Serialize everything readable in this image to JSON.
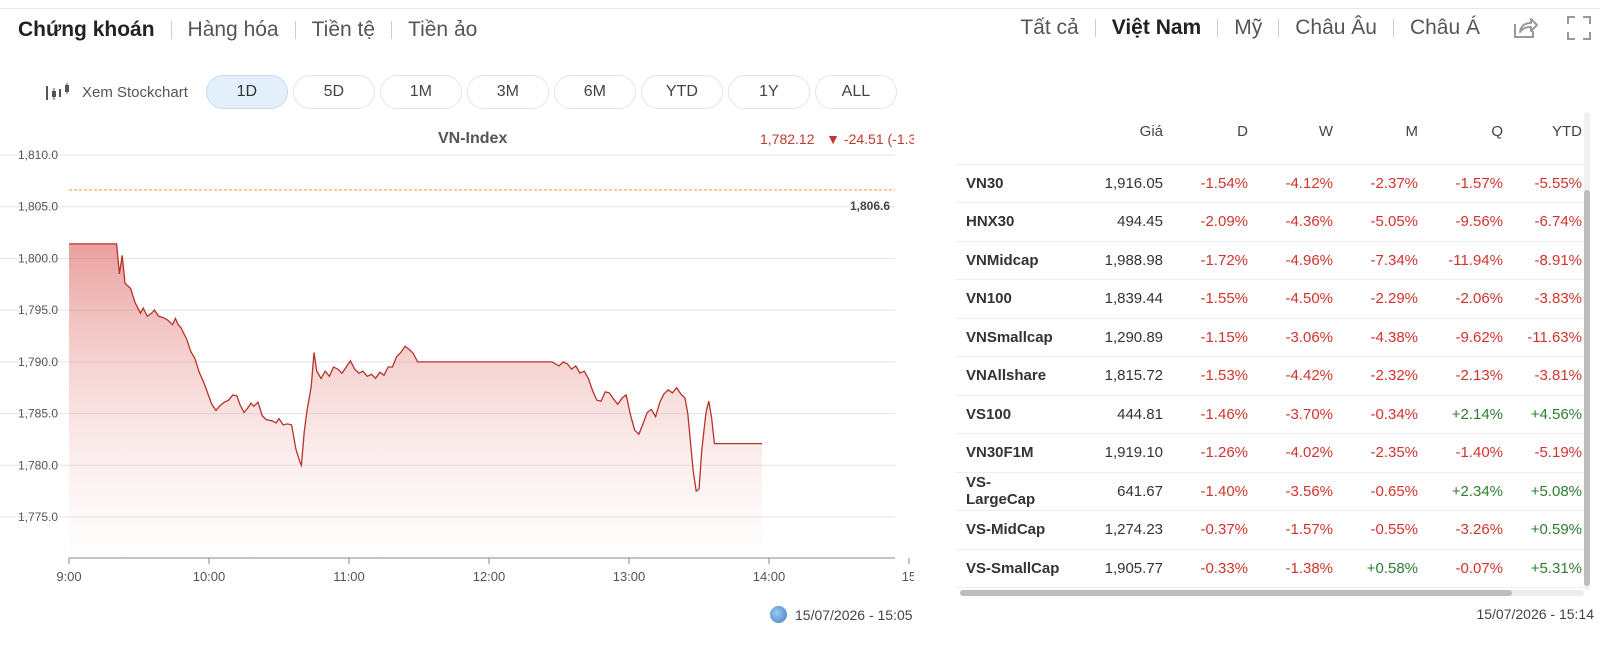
{
  "nav_left": [
    "Chứng khoán",
    "Hàng hóa",
    "Tiền tệ",
    "Tiền ảo"
  ],
  "nav_right": [
    "Tất cả",
    "Việt Nam",
    "Mỹ",
    "Châu Âu",
    "Châu Á"
  ],
  "nav_right_active": "Việt Nam",
  "icons": {
    "share": "share-icon",
    "fullscreen": "fullscreen-icon",
    "stockchart": "candlestick-icon",
    "globe": "globe-icon"
  },
  "toolbar": {
    "stockchart_label": "Xem Stockchart",
    "ranges": [
      "1D",
      "5D",
      "1M",
      "3M",
      "6M",
      "YTD",
      "1Y",
      "ALL"
    ],
    "active_range": "1D"
  },
  "chart": {
    "last_price": "1,782.12",
    "change_text": "▼ -24.51  (-1.3",
    "ref_label": "1,806.6",
    "timestamp": "15/07/2026 - 15:05"
  },
  "chart_data": {
    "type": "area",
    "title": "VN-Index",
    "xlabel": "",
    "ylabel": "",
    "ylim": [
      1775,
      1810
    ],
    "yticks": [
      "1,810.0",
      "1,805.0",
      "1,800.0",
      "1,795.0",
      "1,790.0",
      "1,785.0",
      "1,780.0",
      "1,775.0"
    ],
    "xticks": [
      "9:00",
      "10:00",
      "11:00",
      "12:00",
      "13:00",
      "14:00",
      "15"
    ],
    "reference_line": 1806.63,
    "series": [
      {
        "values": [
          [
            0,
            1801.4
          ],
          [
            8,
            1801.4
          ],
          [
            16,
            1801.4
          ],
          [
            24,
            1801.4
          ],
          [
            28,
            1801.4
          ],
          [
            32,
            1801.4
          ],
          [
            34,
            1801.4
          ],
          [
            36,
            1798.5
          ],
          [
            38,
            1800.3
          ],
          [
            40,
            1797.6
          ],
          [
            44,
            1797.1
          ],
          [
            47,
            1795.8
          ],
          [
            51,
            1794.7
          ],
          [
            53,
            1795.2
          ],
          [
            56,
            1794.4
          ],
          [
            59,
            1794.7
          ],
          [
            61,
            1795.0
          ],
          [
            64,
            1794.4
          ],
          [
            67,
            1794.3
          ],
          [
            70,
            1794.1
          ],
          [
            74,
            1793.6
          ],
          [
            76,
            1794.2
          ],
          [
            78,
            1793.6
          ],
          [
            80,
            1793.3
          ],
          [
            84,
            1792.2
          ],
          [
            87,
            1791.0
          ],
          [
            90,
            1790.3
          ],
          [
            93,
            1789.0
          ],
          [
            96,
            1788.1
          ],
          [
            99,
            1787.0
          ],
          [
            102,
            1785.9
          ],
          [
            105,
            1785.3
          ],
          [
            108,
            1785.8
          ],
          [
            111,
            1786.1
          ],
          [
            114,
            1786.3
          ],
          [
            117,
            1786.8
          ],
          [
            120,
            1786.7
          ],
          [
            122,
            1785.9
          ],
          [
            125,
            1785.1
          ],
          [
            128,
            1785.6
          ],
          [
            130,
            1786.0
          ],
          [
            132,
            1785.7
          ],
          [
            135,
            1786.1
          ],
          [
            138,
            1784.8
          ],
          [
            141,
            1784.4
          ],
          [
            145,
            1784.3
          ],
          [
            148,
            1784.1
          ],
          [
            150,
            1784.5
          ],
          [
            153,
            1783.9
          ],
          [
            156,
            1784.0
          ],
          [
            159,
            1783.9
          ],
          [
            162,
            1781.6
          ],
          [
            165,
            1780.3
          ],
          [
            166,
            1780.0
          ],
          [
            168,
            1783.2
          ],
          [
            170,
            1785.3
          ],
          [
            173,
            1787.6
          ],
          [
            175,
            1790.9
          ],
          [
            177,
            1789.1
          ],
          [
            180,
            1788.4
          ],
          [
            183,
            1789.1
          ],
          [
            186,
            1788.6
          ],
          [
            189,
            1789.5
          ],
          [
            192,
            1789.3
          ],
          [
            195,
            1788.9
          ],
          [
            198,
            1789.5
          ],
          [
            201,
            1790.1
          ],
          [
            204,
            1789.3
          ],
          [
            207,
            1788.9
          ],
          [
            210,
            1789.1
          ],
          [
            213,
            1788.6
          ],
          [
            216,
            1788.8
          ],
          [
            219,
            1788.4
          ],
          [
            222,
            1789.0
          ],
          [
            225,
            1788.7
          ],
          [
            228,
            1789.5
          ],
          [
            231,
            1789.5
          ],
          [
            234,
            1790.5
          ],
          [
            237,
            1790.9
          ],
          [
            240,
            1791.5
          ],
          [
            243,
            1791.2
          ],
          [
            246,
            1790.8
          ],
          [
            249,
            1790.0
          ],
          [
            255,
            1790.0
          ],
          [
            270,
            1790.0
          ],
          [
            300,
            1790.0
          ],
          [
            330,
            1790.0
          ],
          [
            345,
            1790.0
          ],
          [
            350,
            1789.6
          ],
          [
            353,
            1790.0
          ],
          [
            356,
            1789.8
          ],
          [
            359,
            1789.3
          ],
          [
            362,
            1789.6
          ],
          [
            365,
            1788.9
          ],
          [
            368,
            1789.1
          ],
          [
            371,
            1788.4
          ],
          [
            374,
            1787.2
          ],
          [
            377,
            1786.3
          ],
          [
            380,
            1786.2
          ],
          [
            383,
            1787.1
          ],
          [
            386,
            1787.0
          ],
          [
            389,
            1786.4
          ],
          [
            392,
            1785.9
          ],
          [
            395,
            1786.5
          ],
          [
            398,
            1786.8
          ],
          [
            401,
            1784.9
          ],
          [
            404,
            1783.4
          ],
          [
            407,
            1783.0
          ],
          [
            410,
            1784.0
          ],
          [
            413,
            1785.1
          ],
          [
            416,
            1785.4
          ],
          [
            419,
            1784.7
          ],
          [
            422,
            1786.1
          ],
          [
            425,
            1786.9
          ],
          [
            428,
            1787.3
          ],
          [
            431,
            1787.0
          ],
          [
            434,
            1787.5
          ],
          [
            437,
            1786.9
          ],
          [
            440,
            1786.5
          ],
          [
            442,
            1785.0
          ],
          [
            444,
            1782.1
          ],
          [
            446,
            1779.3
          ],
          [
            448,
            1777.5
          ],
          [
            450,
            1777.7
          ],
          [
            452,
            1781.5
          ],
          [
            455,
            1785.1
          ],
          [
            457,
            1786.2
          ],
          [
            459,
            1784.6
          ],
          [
            461,
            1782.1
          ],
          [
            470,
            1782.1
          ],
          [
            480,
            1782.1
          ],
          [
            495,
            1782.1
          ]
        ]
      }
    ]
  },
  "table": {
    "headers": [
      "",
      "Giá",
      "D",
      "W",
      "M",
      "Q",
      "YTD"
    ],
    "rows": [
      {
        "name": "VN30",
        "price": "1,916.05",
        "cells": [
          "-1.54%",
          "-4.12%",
          "-2.37%",
          "-1.57%",
          "-5.55%"
        ]
      },
      {
        "name": "HNX30",
        "price": "494.45",
        "cells": [
          "-2.09%",
          "-4.36%",
          "-5.05%",
          "-9.56%",
          "-6.74%"
        ]
      },
      {
        "name": "VNMidcap",
        "price": "1,988.98",
        "cells": [
          "-1.72%",
          "-4.96%",
          "-7.34%",
          "-11.94%",
          "-8.91%"
        ]
      },
      {
        "name": "VN100",
        "price": "1,839.44",
        "cells": [
          "-1.55%",
          "-4.50%",
          "-2.29%",
          "-2.06%",
          "-3.83%"
        ]
      },
      {
        "name": "VNSmallcap",
        "price": "1,290.89",
        "cells": [
          "-1.15%",
          "-3.06%",
          "-4.38%",
          "-9.62%",
          "-11.63%"
        ]
      },
      {
        "name": "VNAllshare",
        "price": "1,815.72",
        "cells": [
          "-1.53%",
          "-4.42%",
          "-2.32%",
          "-2.13%",
          "-3.81%"
        ]
      },
      {
        "name": "VS100",
        "price": "444.81",
        "cells": [
          "-1.46%",
          "-3.70%",
          "-0.34%",
          "+2.14%",
          "+4.56%"
        ]
      },
      {
        "name": "VN30F1M",
        "price": "1,919.10",
        "cells": [
          "-1.26%",
          "-4.02%",
          "-2.35%",
          "-1.40%",
          "-5.19%"
        ]
      },
      {
        "name": "VS-LargeCap",
        "price": "641.67",
        "cells": [
          "-1.40%",
          "-3.56%",
          "-0.65%",
          "+2.34%",
          "+5.08%"
        ]
      },
      {
        "name": "VS-MidCap",
        "price": "1,274.23",
        "cells": [
          "-0.37%",
          "-1.57%",
          "-0.55%",
          "-3.26%",
          "+0.59%"
        ]
      },
      {
        "name": "VS-SmallCap",
        "price": "1,905.77",
        "cells": [
          "-0.33%",
          "-1.38%",
          "+0.58%",
          "-0.07%",
          "+5.31%"
        ]
      }
    ],
    "timestamp": "15/07/2026 - 15:14"
  },
  "colors": {
    "negative": "#d0342c",
    "positive": "#2e7d32",
    "line": "#b5332a",
    "reference": "#f0a030",
    "active_tab_bg": "#e3effa"
  }
}
